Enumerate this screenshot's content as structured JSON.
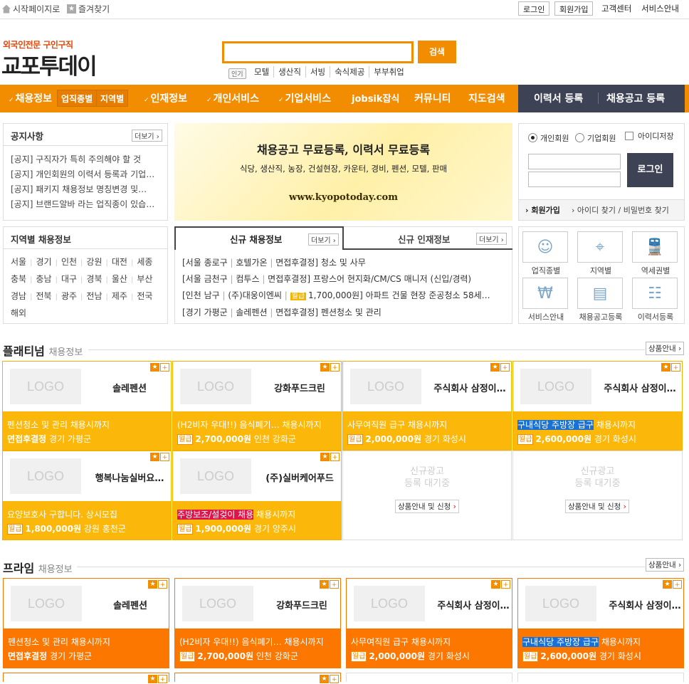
{
  "topbar": {
    "home_label": "시작페이지로",
    "fav_label": "즐겨찾기",
    "login": "로그인",
    "signup": "회원가입",
    "customer_center": "고객센터",
    "service_guide": "서비스안내"
  },
  "header": {
    "logo_sub": "외국인전문 구인구직",
    "logo_main": "교포투데이",
    "search_button": "검색",
    "popular_label": "인기",
    "popular_keywords": [
      "모텔",
      "생산직",
      "서빙",
      "숙식제공",
      "부부취업"
    ]
  },
  "nav": {
    "jobs": "채용정보",
    "by_type": "업직종별",
    "by_region": "지역별",
    "talent": "인재정보",
    "personal": "개인서비스",
    "corporate": "기업서비스",
    "jobsik": "jobsik잡식",
    "community": "커뮤니티",
    "map": "지도검색",
    "resume_register": "이력서 등록",
    "job_register": "채용공고 등록"
  },
  "notice": {
    "title": "공지사항",
    "more": "더보기",
    "items": [
      "[공지] 구직자가 특히 주의해야 할 것",
      "[공지] 개인회원의 이력서 등록과 기업…",
      "[공지] 패키지 채용정보 명칭변경 및…",
      "[공지] 브랜드알바 라는 업직종이 있습…"
    ]
  },
  "banner": {
    "headline": "채용공고 무료등록, 이력서 무료등록",
    "sub": "식당, 생산직, 농장, 건설현장, 카운터, 경비, 펜션, 모텔, 판매",
    "url": "www.kyopotoday.com"
  },
  "login_box": {
    "personal": "개인회원",
    "corporate": "기업회원",
    "save_id": "아이디저장",
    "login_button": "로그인",
    "join": "회원가입",
    "find": "아이디 찾기 / 비밀번호 찾기"
  },
  "region": {
    "title": "지역별 채용정보",
    "rows": [
      [
        "서울",
        "경기",
        "인천",
        "강원",
        "대전",
        "세종"
      ],
      [
        "충북",
        "충남",
        "대구",
        "경북",
        "울산",
        "부산"
      ],
      [
        "경남",
        "전북",
        "광주",
        "전남",
        "제주",
        "전국"
      ],
      [
        "해외"
      ]
    ]
  },
  "newjobs": {
    "tab_jobs": "신규 채용정보",
    "tab_talent": "신규 인재정보",
    "more": "더보기",
    "items": [
      {
        "loc": "[서울 종로구",
        "company": "호텔가온",
        "cond": "면접후결정",
        "title": "] 청소 및 사무",
        "pay": ""
      },
      {
        "loc": "[서울 금천구",
        "company": "컴투스",
        "cond": "면접후결정",
        "title": "] 프랑스어 현지화/CM/CS 매니저 (신입/경력)",
        "pay": ""
      },
      {
        "loc": "[인천 남구",
        "company": "(주)대웅이엔씨",
        "cond": "",
        "title": "] 아파트 건물 현장 준공청소 58세…",
        "pay": "1,700,000원"
      },
      {
        "loc": "[경기 가평군",
        "company": "솔레펜션",
        "cond": "면접후결정",
        "title": "] 펜션청소 및 관리",
        "pay": ""
      }
    ],
    "pay_label": "월급"
  },
  "quick": {
    "items": [
      {
        "icon": "person-icon",
        "label": "업직종별"
      },
      {
        "icon": "map-icon",
        "label": "지역별"
      },
      {
        "icon": "train-icon",
        "label": "역세권별"
      },
      {
        "icon": "won-icon",
        "label": "서비스안내"
      },
      {
        "icon": "document-icon",
        "label": "채용공고등록"
      },
      {
        "icon": "resume-icon",
        "label": "이력서등록"
      }
    ]
  },
  "platinum": {
    "title": "플래티넘",
    "sub": "채용정보",
    "guide": "상품안내",
    "cards": [
      {
        "company": "솔레펜션",
        "job": "펜션청소 및 관리 채용시까지",
        "job_hl": "",
        "cond": "면접후결정",
        "pay": "",
        "loc": "경기 가평군"
      },
      {
        "company": "강화푸드크린",
        "job": "(H2비자 우대!!) 음식폐기… 채용시까지",
        "job_hl": "",
        "cond": "",
        "pay": "2,700,000원",
        "loc": "인천 강화군"
      },
      {
        "company": "주식회사 삼정이…",
        "job": "사무여직원 급구 채용시까지",
        "job_hl": "",
        "cond": "",
        "pay": "2,000,000원",
        "loc": "경기 화성시"
      },
      {
        "company": "주식회사 삼정이…",
        "job": "채용시까지",
        "job_hl": "구내식당 주방장 급구",
        "hl_color": "blue",
        "cond": "",
        "pay": "2,600,000원",
        "loc": "경기 화성시"
      },
      {
        "company": "행복나눔실버요…",
        "job": "요양보호사 구합니다. 상시모집",
        "job_hl": "",
        "cond": "",
        "pay": "1,800,000원",
        "loc": "강원 홍천군"
      },
      {
        "company": "(주)실버케어푸드",
        "job": "채용시까지",
        "job_hl": "주방보조/설겆이 채용",
        "hl_color": "red",
        "cond": "",
        "pay": "1,900,000원",
        "loc": "경기 양주시"
      }
    ],
    "empty_text_1": "신규광고",
    "empty_text_2": "등록 대기중",
    "empty_button": "상품안내 및 신청"
  },
  "prime": {
    "title": "프라임",
    "sub": "채용정보",
    "guide": "상품안내",
    "cards": [
      {
        "company": "솔레펜션",
        "job": "펜션청소 및 관리 채용시까지",
        "job_hl": "",
        "cond": "면접후결정",
        "pay": "",
        "loc": "경기 가평군"
      },
      {
        "company": "강화푸드크린",
        "job": "(H2비자 우대!!) 음식폐기… 채용시까지",
        "job_hl": "",
        "cond": "",
        "pay": "2,700,000원",
        "loc": "인천 강화군"
      },
      {
        "company": "주식회사 삼정이…",
        "job": "사무여직원 급구 채용시까지",
        "job_hl": "",
        "cond": "",
        "pay": "2,000,000원",
        "loc": "경기 화성시"
      },
      {
        "company": "주식회사 삼정이…",
        "job": "채용시까지",
        "job_hl": "구내식당 주방장 급구",
        "hl_color": "blue",
        "cond": "",
        "pay": "2,600,000원",
        "loc": "경기 화성시"
      }
    ]
  },
  "common": {
    "logo_placeholder": "LOGO",
    "pay_label": "월급"
  },
  "colors": {
    "brand_orange": "#f28c00",
    "platinum_bg": "#fcb80a",
    "prime_bg": "#fb7700",
    "nav_dark": "#3d4355"
  }
}
